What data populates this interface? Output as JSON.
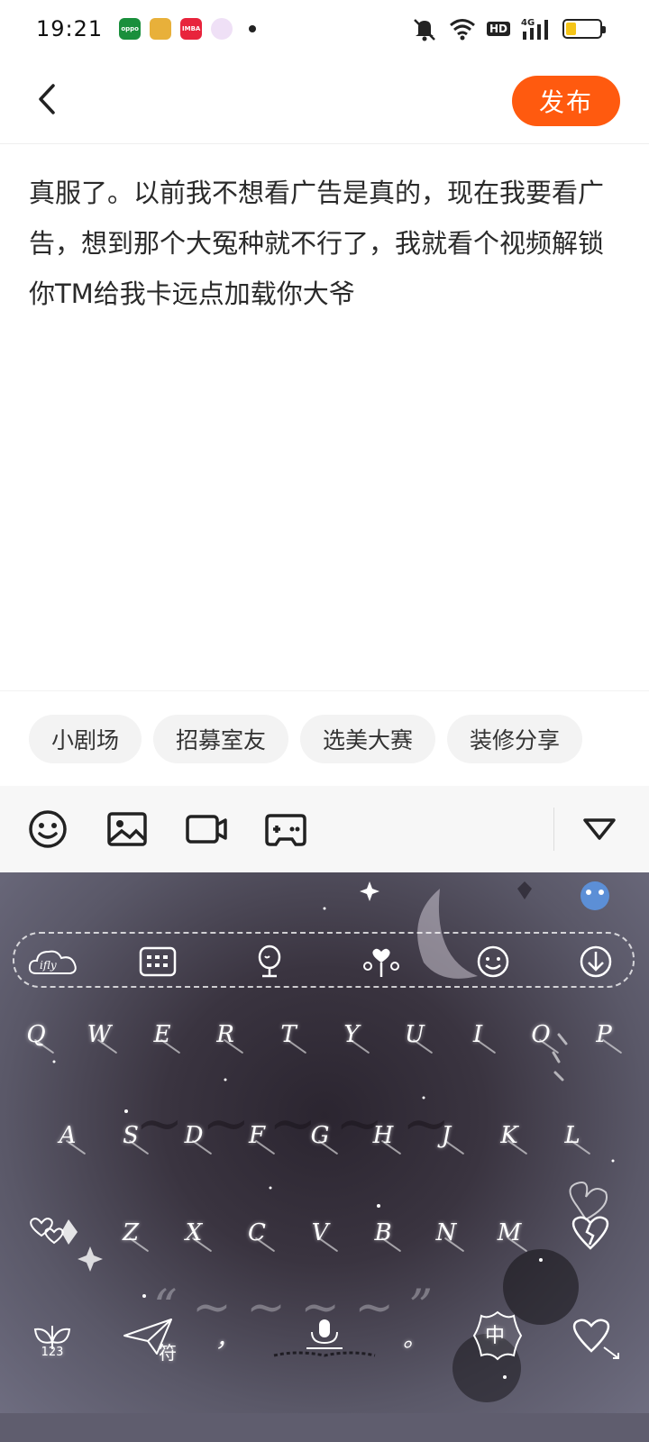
{
  "status_bar": {
    "time": "19:21",
    "apps": [
      {
        "icon": "oppo-app-icon",
        "label": "oppo",
        "color": "#1a8f3c"
      },
      {
        "icon": "game-app-icon",
        "label": "",
        "color": "#e8b03a"
      },
      {
        "icon": "shop-app-icon",
        "label": "IMBA",
        "color": "#e8243c"
      },
      {
        "icon": "heart-app-icon",
        "label": "",
        "color": "#e9d6f2"
      }
    ],
    "hd_label": "HD",
    "network_label": "4G",
    "battery_level": 0.3
  },
  "header": {
    "publish_label": "发布"
  },
  "post": {
    "text": "真服了。以前我不想看广告是真的，现在我要看广告，想到那个大冤种就不行了，我就看个视频解锁你TM给我卡远点加载你大爷"
  },
  "tags": [
    "小剧场",
    "招募室友",
    "选美大赛",
    "装修分享"
  ],
  "keyboard": {
    "logo": "ifly",
    "row1": [
      "Q",
      "W",
      "E",
      "R",
      "T",
      "Y",
      "U",
      "I",
      "O",
      "P"
    ],
    "row2": [
      "A",
      "S",
      "D",
      "F",
      "G",
      "H",
      "J",
      "K",
      "L"
    ],
    "row3": [
      "Z",
      "X",
      "C",
      "V",
      "B",
      "N",
      "M"
    ],
    "bottom": {
      "num_label": "123",
      "symbol_label": "符",
      "comma_label": "，",
      "period_label": "。",
      "lang_label": "中"
    }
  },
  "colors": {
    "accent": "#ff5a0f",
    "tag_bg": "#f3f3f3",
    "toolbar_bg": "#f7f7f7"
  }
}
